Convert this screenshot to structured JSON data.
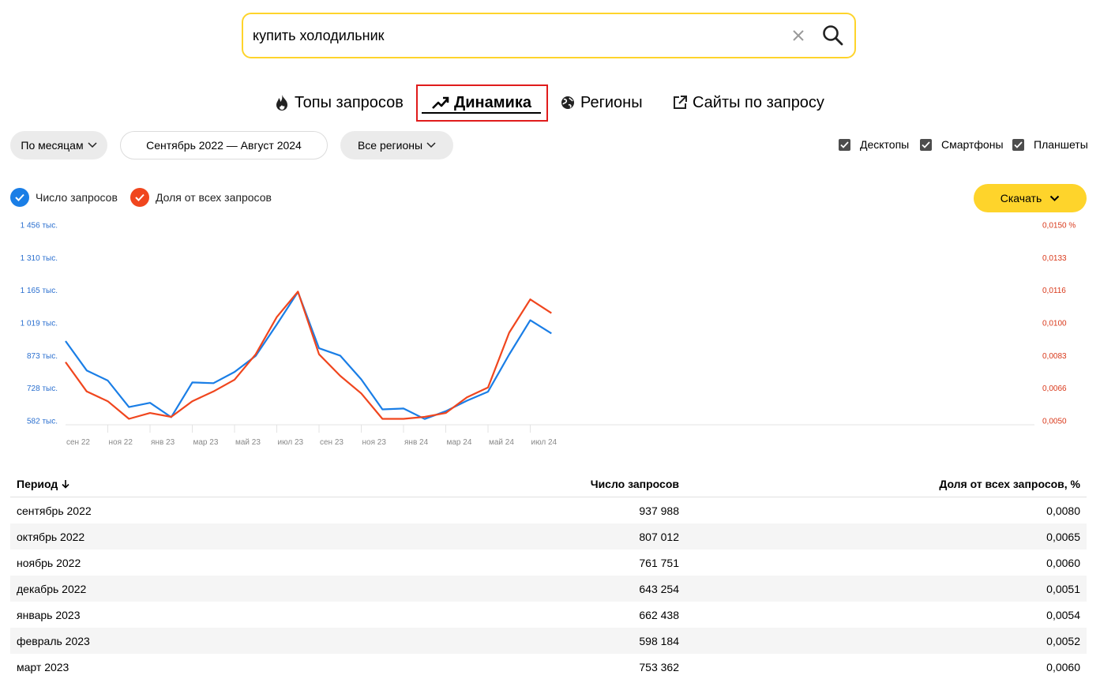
{
  "search": {
    "value": "купить холодильник"
  },
  "tabs": [
    {
      "label": "Топы запросов",
      "icon": "flame-icon"
    },
    {
      "label": "Динамика",
      "icon": "trend-up-icon",
      "active": true
    },
    {
      "label": "Регионы",
      "icon": "globe-icon"
    },
    {
      "label": "Сайты по запросу",
      "icon": "external-link-icon"
    }
  ],
  "filters": {
    "period_grouping": "По месяцам",
    "date_range": "Сентябрь 2022 — Август 2024",
    "regions": "Все регионы"
  },
  "devices": [
    {
      "label": "Десктопы",
      "checked": true
    },
    {
      "label": "Смартфоны",
      "checked": true
    },
    {
      "label": "Планшеты",
      "checked": true
    }
  ],
  "legend": [
    {
      "label": "Число запросов",
      "color": "#1a7ee6"
    },
    {
      "label": "Доля от всех запросов",
      "color": "#f0461e"
    }
  ],
  "download_label": "Скачать",
  "chart_data": {
    "type": "line",
    "x": [
      "сен 22",
      "окт 22",
      "ноя 22",
      "дек 22",
      "янв 23",
      "фев 23",
      "мар 23",
      "апр 23",
      "май 23",
      "июн 23",
      "июл 23",
      "авг 23",
      "сен 23",
      "окт 23",
      "ноя 23",
      "дек 23",
      "янв 24",
      "фев 24",
      "мар 24",
      "апр 24",
      "май 24",
      "июн 24",
      "июл 24",
      "авг 24"
    ],
    "x_tick_labels": [
      "сен 22",
      "ноя 22",
      "янв 23",
      "мар 23",
      "май 23",
      "июл 23",
      "сен 23",
      "ноя 23",
      "янв 24",
      "мар 24",
      "май 24",
      "июл 24"
    ],
    "y_left_ticks": [
      "1 456 тыс.",
      "1 310 тыс.",
      "1 165 тыс.",
      "1 019 тыс.",
      "873 тыс.",
      "728 тыс.",
      "582 тыс."
    ],
    "y_right_ticks": [
      "0,0150 %",
      "0,0133",
      "0,0116",
      "0,0100",
      "0,0083",
      "0,0066",
      "0,0050"
    ],
    "ylim_left": [
      582,
      1456
    ],
    "ylim_right": [
      0.005,
      0.015
    ],
    "series": [
      {
        "name": "Число запросов",
        "axis": "left",
        "color": "#1a7ee6",
        "values": [
          937.988,
          807.012,
          761.751,
          643.254,
          662.438,
          598.184,
          753.362,
          750,
          800,
          872,
          1012,
          1157,
          906,
          873,
          767,
          633,
          637,
          590,
          625,
          672,
          712,
          878,
          1031,
          972
        ]
      },
      {
        "name": "Доля от всех запросов",
        "axis": "right",
        "color": "#f0461e",
        "values": [
          0.008,
          0.0065,
          0.006,
          0.0051,
          0.0054,
          0.0052,
          0.006,
          0.0065,
          0.0071,
          0.0084,
          0.0103,
          0.0116,
          0.0084,
          0.0073,
          0.0064,
          0.0051,
          0.0051,
          0.0052,
          0.0054,
          0.0062,
          0.0067,
          0.0095,
          0.0112,
          0.0105
        ]
      }
    ]
  },
  "table": {
    "headers": {
      "period": "Период",
      "count": "Число запросов",
      "share": "Доля от всех запросов, %"
    },
    "rows": [
      {
        "period": "сентябрь 2022",
        "count": "937 988",
        "share": "0,0080"
      },
      {
        "period": "октябрь 2022",
        "count": "807 012",
        "share": "0,0065"
      },
      {
        "period": "ноябрь 2022",
        "count": "761 751",
        "share": "0,0060"
      },
      {
        "period": "декабрь 2022",
        "count": "643 254",
        "share": "0,0051"
      },
      {
        "period": "январь 2023",
        "count": "662 438",
        "share": "0,0054"
      },
      {
        "period": "февраль 2023",
        "count": "598 184",
        "share": "0,0052"
      },
      {
        "period": "март 2023",
        "count": "753 362",
        "share": "0,0060"
      }
    ]
  }
}
